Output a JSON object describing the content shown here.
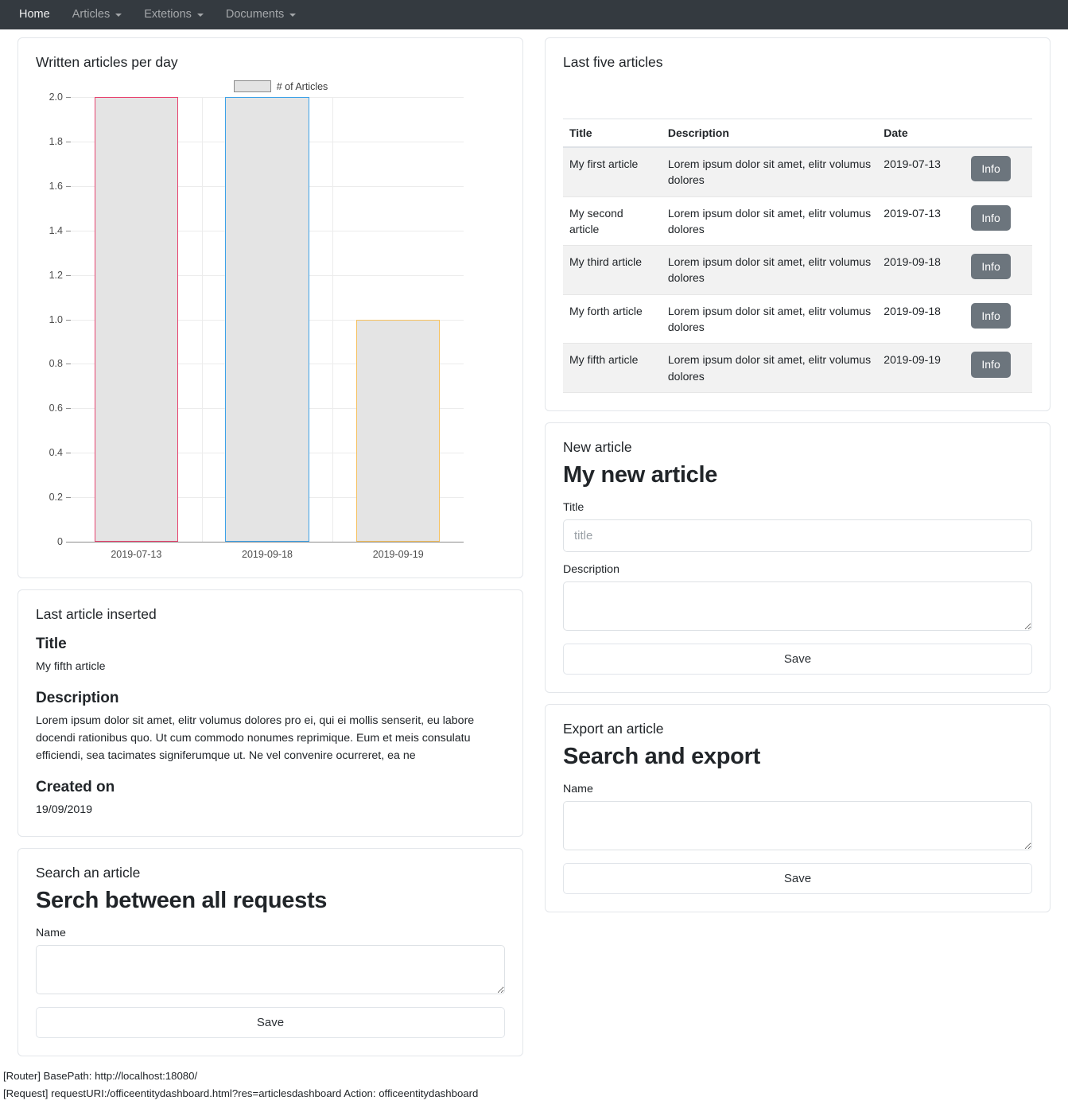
{
  "navbar": {
    "items": [
      {
        "label": "Home",
        "has_caret": false
      },
      {
        "label": "Articles",
        "has_caret": true
      },
      {
        "label": "Extetions",
        "has_caret": true
      },
      {
        "label": "Documents",
        "has_caret": true
      }
    ]
  },
  "chart_card": {
    "title": "Written articles per day"
  },
  "chart_data": {
    "type": "bar",
    "title": "Written articles per day",
    "categories": [
      "2019-07-13",
      "2019-09-18",
      "2019-09-19"
    ],
    "values": [
      2,
      2,
      1
    ],
    "series": [
      {
        "name": "# of Articles",
        "values": [
          2,
          2,
          1
        ]
      }
    ],
    "bar_colors": [
      "#e8426e",
      "#3da2e8",
      "#f5c05e"
    ],
    "bar_fill": "#e4e4e4",
    "legend": [
      "# of Articles"
    ],
    "legend_position": "top-center",
    "xlabel": "",
    "ylabel": "",
    "ylim": [
      0,
      2
    ],
    "yticks": [
      "0",
      "0.2",
      "0.4",
      "0.6",
      "0.8",
      "1.0",
      "1.2",
      "1.4",
      "1.6",
      "1.8",
      "2.0"
    ],
    "ytick_values": [
      0,
      0.2,
      0.4,
      0.6,
      0.8,
      1.0,
      1.2,
      1.4,
      1.6,
      1.8,
      2.0
    ],
    "grid": true
  },
  "articles_card": {
    "title": "Last five articles",
    "columns": [
      "Title",
      "Description",
      "Date"
    ],
    "action_label": "Info",
    "rows": [
      {
        "title": "My first article",
        "description": "Lorem ipsum dolor sit amet, elitr volumus dolores",
        "date": "2019-07-13",
        "action": "Info"
      },
      {
        "title": "My second article",
        "description": "Lorem ipsum dolor sit amet, elitr volumus dolores",
        "date": "2019-07-13",
        "action": "Info"
      },
      {
        "title": "My third article",
        "description": "Lorem ipsum dolor sit amet, elitr volumus dolores",
        "date": "2019-09-18",
        "action": "Info"
      },
      {
        "title": "My forth article",
        "description": "Lorem ipsum dolor sit amet, elitr volumus dolores",
        "date": "2019-09-18",
        "action": "Info"
      },
      {
        "title": "My fifth article",
        "description": "Lorem ipsum dolor sit amet, elitr volumus dolores",
        "date": "2019-09-19",
        "action": "Info"
      }
    ]
  },
  "last_article": {
    "title": "Last article inserted",
    "title_label": "Title",
    "title_value": "My fifth article",
    "description_label": "Description",
    "description_value": "Lorem ipsum dolor sit amet, elitr volumus dolores pro ei, qui ei mollis senserit, eu labore docendi rationibus quo. Ut cum commodo nonumes reprimique. Eum et meis consulatu efficiendi, sea tacimates signiferumque ut. Ne vel convenire ocurreret, ea ne",
    "created_label": "Created on",
    "created_value": "19/09/2019"
  },
  "new_article": {
    "title": "New article",
    "heading": "My new article",
    "title_label": "Title",
    "title_placeholder": "title",
    "title_value": "",
    "description_label": "Description",
    "description_value": "",
    "save_label": "Save"
  },
  "search_article": {
    "title": "Search an article",
    "heading": "Serch between all requests",
    "name_label": "Name",
    "name_value": "",
    "save_label": "Save"
  },
  "export_article": {
    "title": "Export an article",
    "heading": "Search and export",
    "name_label": "Name",
    "name_value": "",
    "save_label": "Save"
  },
  "footer": {
    "line1": "[Router] BasePath: http://localhost:18080/",
    "line2": "[Request] requestURI:/officeentitydashboard.html?res=articlesdashboard Action: officeentitydashboard"
  }
}
